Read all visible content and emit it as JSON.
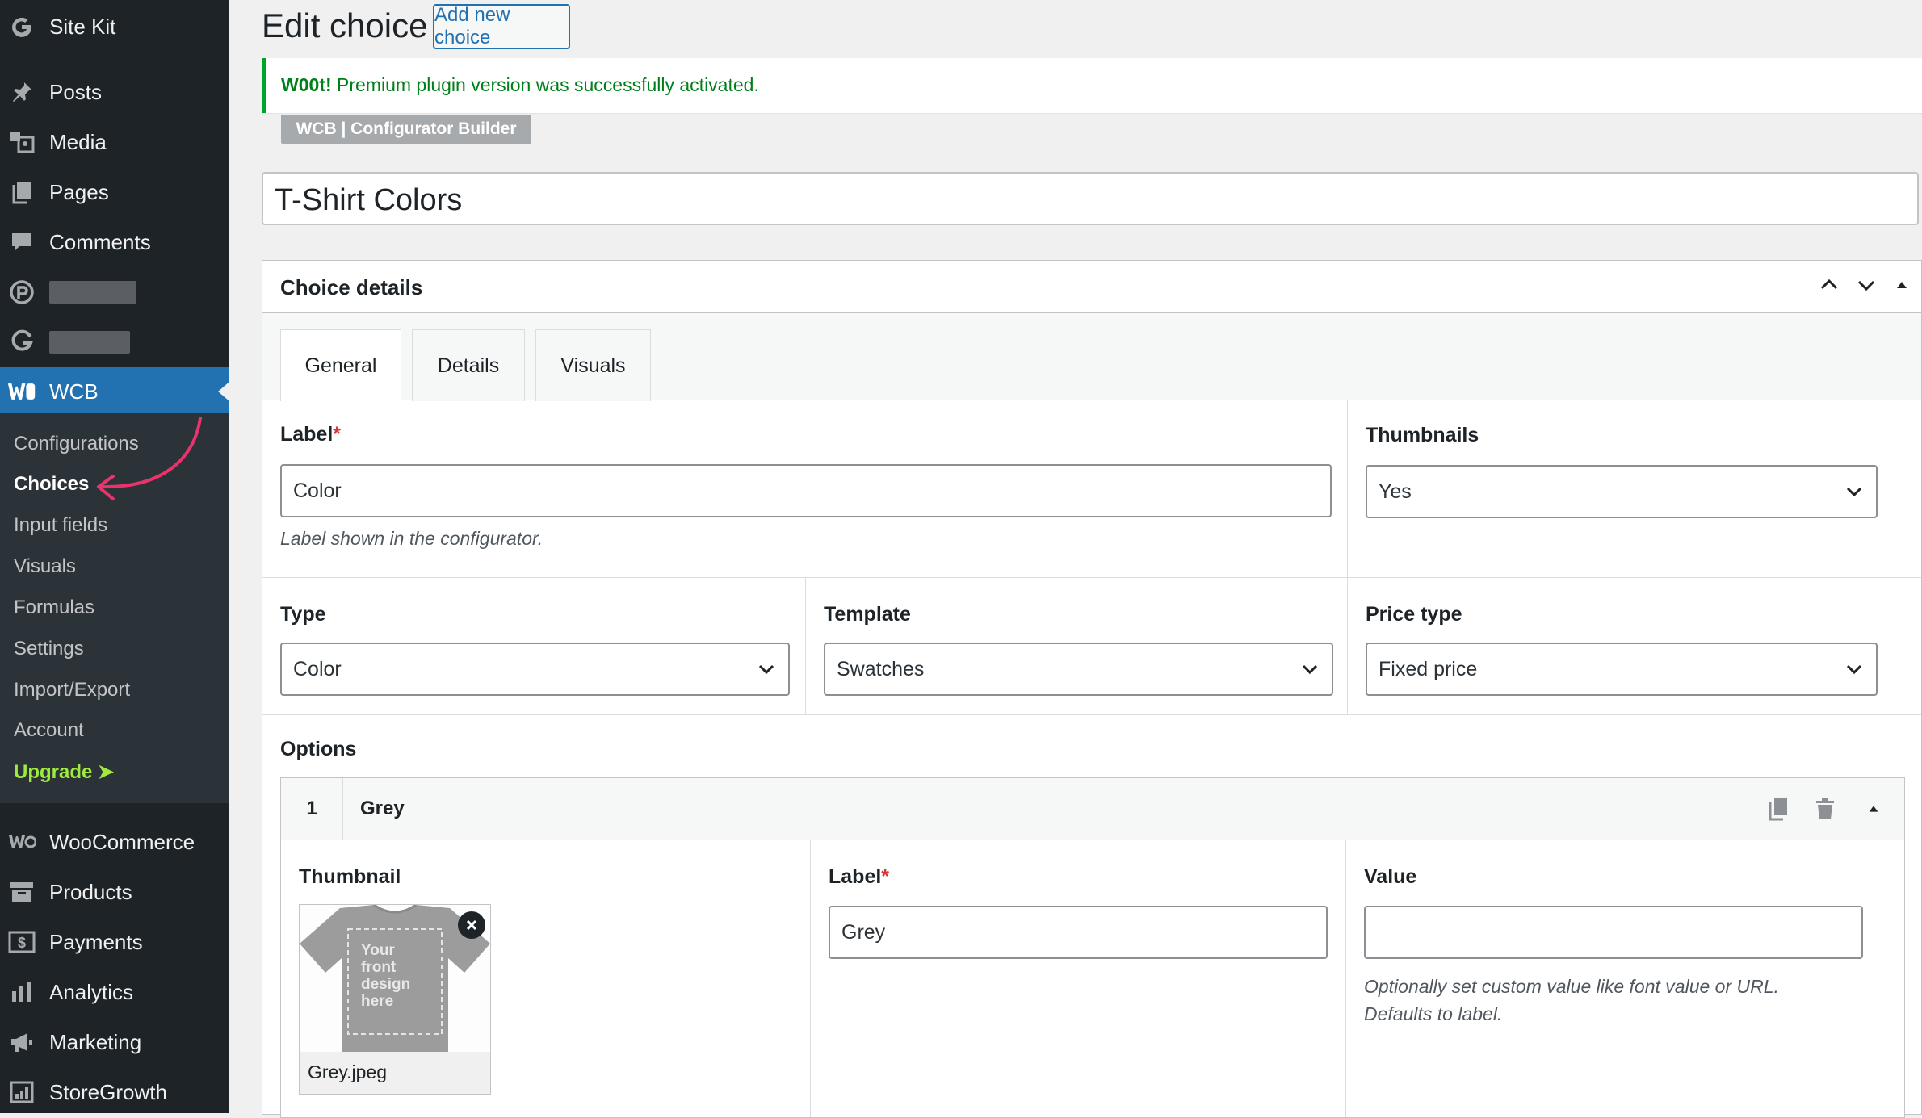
{
  "sidebar": {
    "top_items": [
      {
        "label": "Site Kit",
        "icon": "google-g-icon"
      },
      {
        "label": "Posts",
        "icon": "pushpin-icon"
      },
      {
        "label": "Media",
        "icon": "media-icon"
      },
      {
        "label": "Pages",
        "icon": "pages-icon"
      },
      {
        "label": "Comments",
        "icon": "comment-icon"
      }
    ],
    "active_item": {
      "label": "WCB",
      "icon": "wcb-logo-icon"
    },
    "submenu": [
      {
        "label": "Configurations"
      },
      {
        "label": "Choices"
      },
      {
        "label": "Input fields"
      },
      {
        "label": "Visuals"
      },
      {
        "label": "Formulas"
      },
      {
        "label": "Settings"
      },
      {
        "label": "Import/Export"
      },
      {
        "label": "Account"
      },
      {
        "label": "Upgrade ➤"
      }
    ],
    "bottom_items": [
      {
        "label": "WooCommerce",
        "icon": "woo-icon"
      },
      {
        "label": "Products",
        "icon": "archive-icon"
      },
      {
        "label": "Payments",
        "icon": "payment-icon"
      },
      {
        "label": "Analytics",
        "icon": "bar-chart-icon"
      },
      {
        "label": "Marketing",
        "icon": "megaphone-icon"
      },
      {
        "label": "StoreGrowth",
        "icon": "growth-icon"
      }
    ],
    "accent_color": "#2271b1",
    "upgrade_color": "#9eea3f"
  },
  "header": {
    "title": "Edit choice",
    "add_new_label": "Add new choice"
  },
  "notice": {
    "strong": "W00t!",
    "text": " Premium plugin version was successfully activated."
  },
  "builder_badge": "WCB | Configurator Builder",
  "post_title": "T-Shirt Colors",
  "choice_details": {
    "title": "Choice details",
    "tabs": [
      "General",
      "Details",
      "Visuals"
    ],
    "active_tab": "General",
    "label_field": {
      "label": "Label",
      "required": "*",
      "value": "Color",
      "help": "Label shown in the configurator."
    },
    "thumbnails_field": {
      "label": "Thumbnails",
      "value": "Yes"
    },
    "type_field": {
      "label": "Type",
      "value": "Color"
    },
    "template_field": {
      "label": "Template",
      "value": "Swatches"
    },
    "price_type_field": {
      "label": "Price type",
      "value": "Fixed price"
    },
    "options_label": "Options",
    "options": [
      {
        "number": "1",
        "name": "Grey",
        "thumbnail_label": "Thumbnail",
        "thumbnail_file": "Grey.jpeg",
        "thumbnail_overlay_text": "Your front design here",
        "label_label": "Label",
        "label_required": "*",
        "label_value": "Grey",
        "value_label": "Value",
        "value_value": "",
        "value_help": "Optionally set custom value like font value or URL. Defaults to label."
      }
    ]
  },
  "annotation_color": "#e8336d"
}
